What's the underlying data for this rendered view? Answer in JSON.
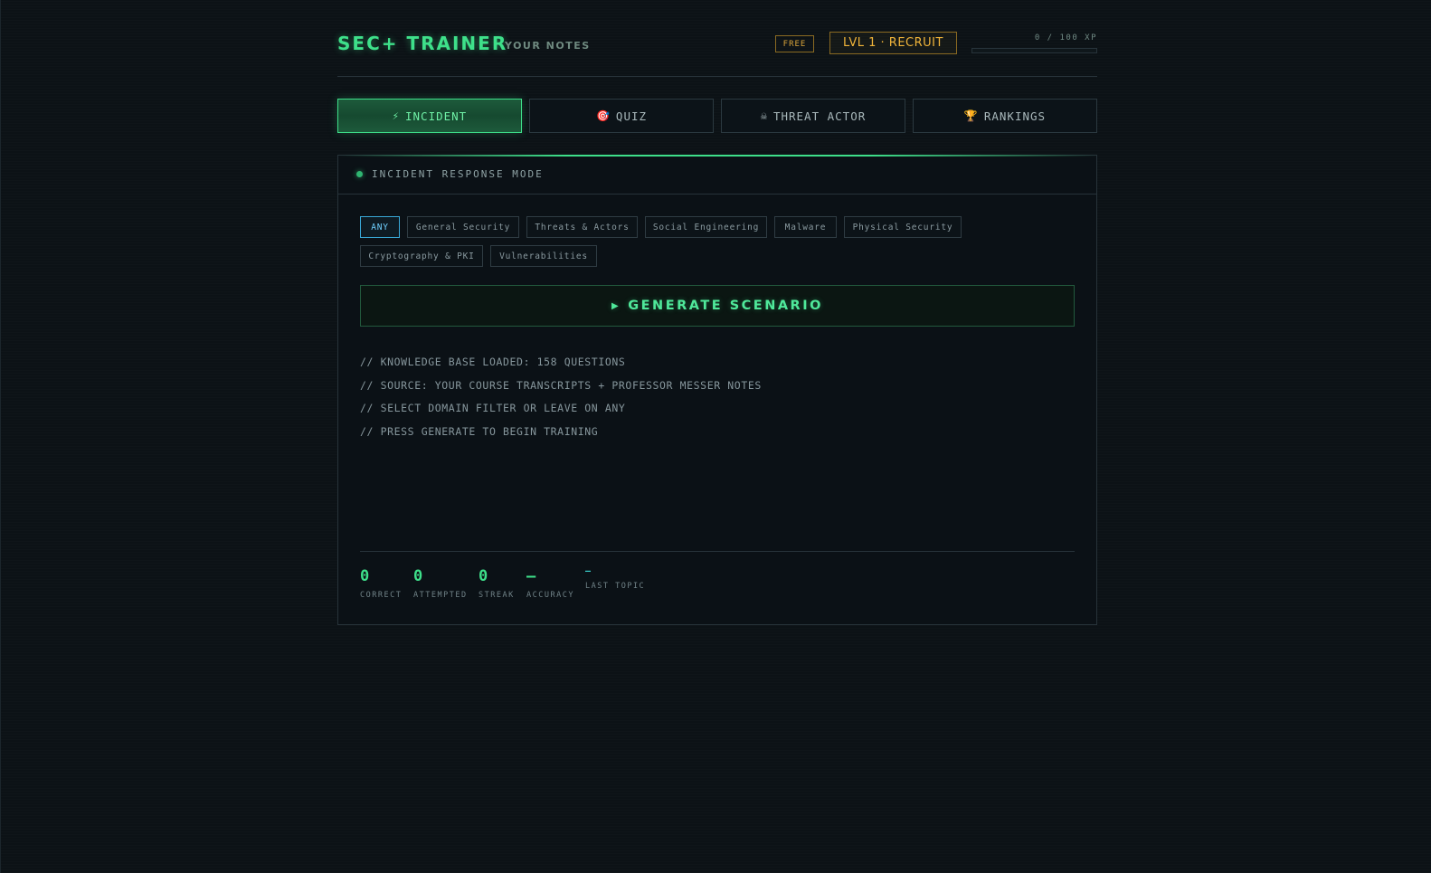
{
  "header": {
    "brand": "SEC+ TRAINER",
    "subtitle": "YOUR NOTES",
    "plan_badge": "FREE",
    "level_badge": "LVL 1 · RECRUIT",
    "xp_label": "0 / 100 XP",
    "xp_progress": 0
  },
  "tabs": [
    {
      "icon": "⚡",
      "label": "INCIDENT",
      "active": true
    },
    {
      "icon": "🎯",
      "label": "QUIZ",
      "active": false
    },
    {
      "icon": "☠",
      "label": "THREAT ACTOR",
      "active": false
    },
    {
      "icon": "🏆",
      "label": "RANKINGS",
      "active": false
    }
  ],
  "panel": {
    "title": "INCIDENT RESPONSE MODE",
    "domains": [
      {
        "label": "ANY",
        "active": true
      },
      {
        "label": "General Security",
        "active": false
      },
      {
        "label": "Threats & Actors",
        "active": false
      },
      {
        "label": "Social Engineering",
        "active": false
      },
      {
        "label": "Malware",
        "active": false
      },
      {
        "label": "Physical Security",
        "active": false
      },
      {
        "label": "Cryptography & PKI",
        "active": false
      },
      {
        "label": "Vulnerabilities",
        "active": false
      }
    ],
    "generate_label": "GENERATE SCENARIO",
    "log_lines": [
      "// KNOWLEDGE BASE LOADED: 158 QUESTIONS",
      "// SOURCE: YOUR COURSE TRANSCRIPTS + PROFESSOR MESSER NOTES",
      "// SELECT DOMAIN FILTER OR LEAVE ON ANY",
      "// PRESS GENERATE TO BEGIN TRAINING"
    ],
    "stats": {
      "correct": {
        "value": "0",
        "label": "CORRECT"
      },
      "attempted": {
        "value": "0",
        "label": "ATTEMPTED"
      },
      "streak": {
        "value": "0",
        "label": "STREAK"
      },
      "accuracy": {
        "value": "—",
        "label": "ACCURACY"
      },
      "last_topic": {
        "value": "—",
        "label": "LAST TOPIC"
      }
    }
  },
  "colors": {
    "accent": "#3ee08a",
    "gold": "#f0b43a",
    "cyan": "#39a9d8",
    "background": "#0c1216"
  }
}
